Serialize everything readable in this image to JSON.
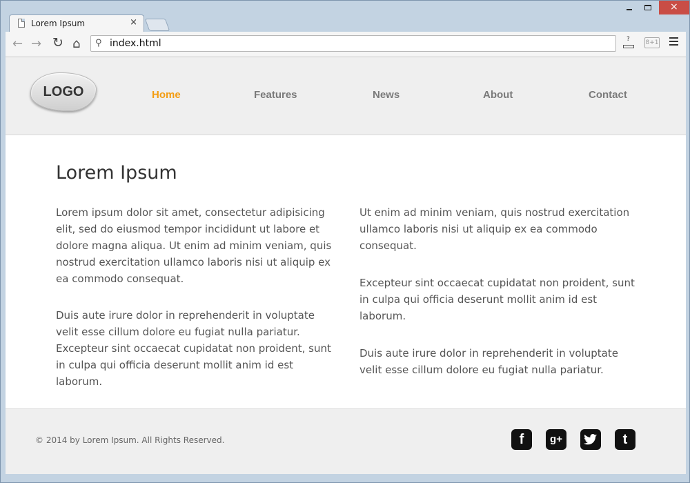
{
  "browser": {
    "tab_title": "Lorem Ipsum",
    "tab_close": "×",
    "address": "index.html",
    "ext_label": "?",
    "gplus_label": "8+1",
    "window_close": "×"
  },
  "site": {
    "logo_text": "LOGO",
    "nav": [
      "Home",
      "Features",
      "News",
      "About",
      "Contact"
    ],
    "active_nav": "Home",
    "accent_color": "#f39c11"
  },
  "main": {
    "title": "Lorem Ipsum",
    "left_column": [
      "Lorem ipsum dolor sit amet, consectetur adipisicing elit, sed do eiusmod tempor incididunt ut labore et dolore magna aliqua. Ut enim ad minim veniam, quis nostrud exercitation ullamco laboris nisi ut aliquip ex ea commodo consequat.",
      "Duis aute irure dolor in reprehenderit in voluptate velit esse cillum dolore eu fugiat nulla pariatur. Excepteur sint occaecat cupidatat non proident, sunt in culpa qui officia deserunt mollit anim id est laborum."
    ],
    "right_column": [
      "Ut enim ad minim veniam, quis nostrud exercitation ullamco laboris nisi ut aliquip ex ea commodo consequat.",
      "Excepteur sint occaecat cupidatat non proident, sunt in culpa qui officia deserunt mollit anim id est laborum.",
      "Duis aute irure dolor in reprehenderit in voluptate velit esse cillum dolore eu fugiat nulla pariatur."
    ]
  },
  "footer": {
    "copyright": "© 2014 by Lorem Ipsum. All Rights Reserved.",
    "social": [
      {
        "name": "facebook-icon",
        "glyph": "f"
      },
      {
        "name": "google-plus-icon",
        "glyph": "g+"
      },
      {
        "name": "twitter-icon",
        "glyph": "🐦"
      },
      {
        "name": "tumblr-icon",
        "glyph": "t"
      }
    ]
  }
}
